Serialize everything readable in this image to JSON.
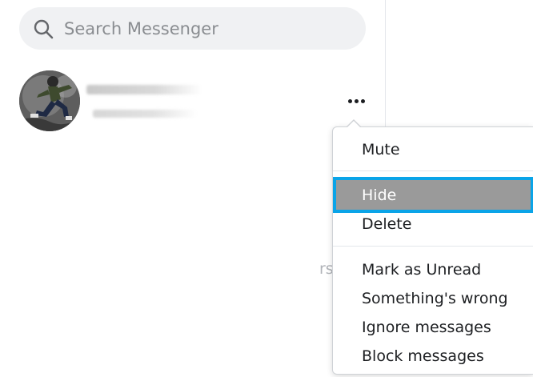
{
  "search": {
    "placeholder": "Search Messenger",
    "icon": "search-icon"
  },
  "conversation": {
    "avatar_icon": "avatar",
    "more_icon": "more-dots-icon"
  },
  "background_partial_text": "rs",
  "context_menu": {
    "items": [
      {
        "label": "Mute"
      },
      {
        "label": "Hide",
        "highlighted": true,
        "highlight_color": "#0aa4e8"
      },
      {
        "label": "Delete"
      },
      {
        "label": "Mark as Unread"
      },
      {
        "label": "Something's wrong"
      },
      {
        "label": "Ignore messages"
      },
      {
        "label": "Block messages"
      }
    ]
  }
}
